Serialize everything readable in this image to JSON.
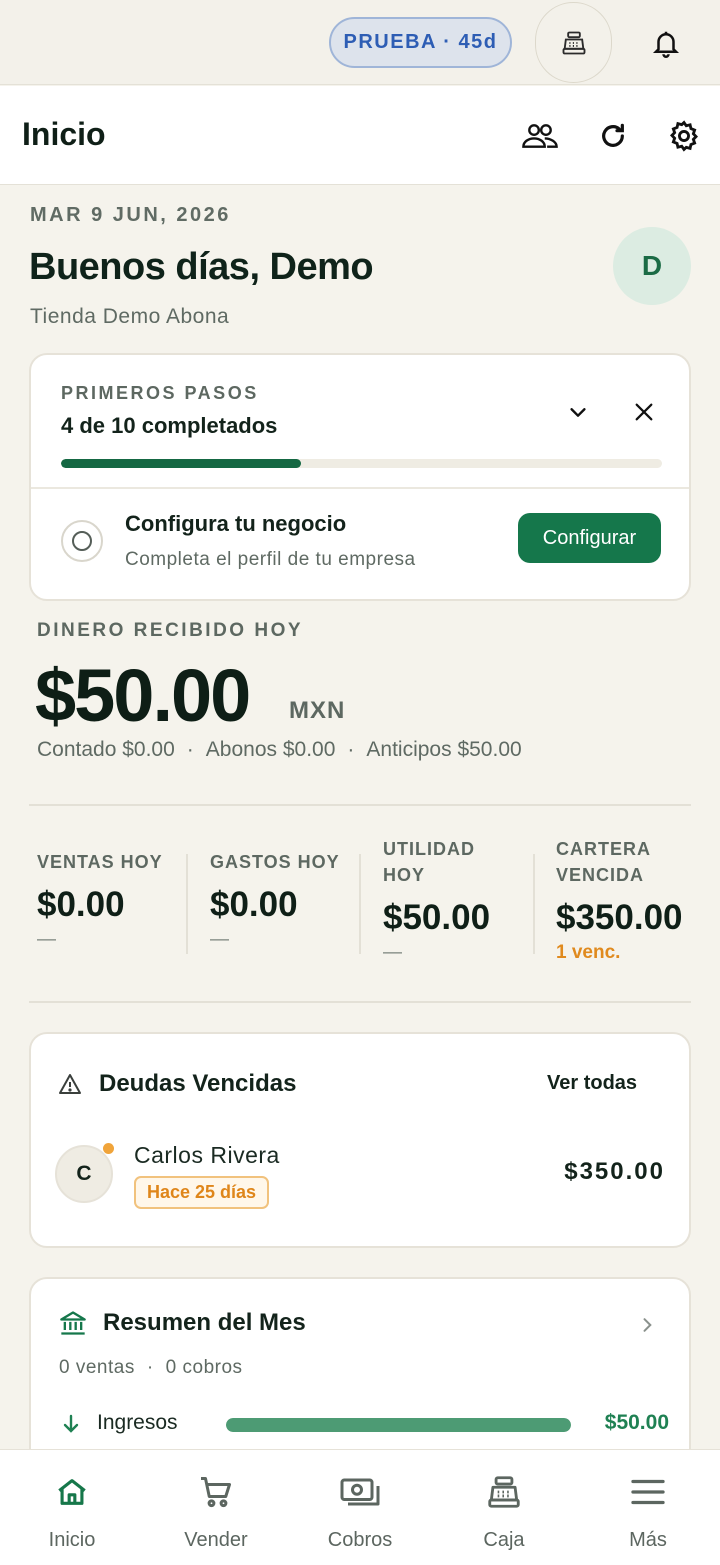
{
  "status": {
    "trial_badge": "PRUEBA · 45d"
  },
  "header": {
    "title": "Inicio"
  },
  "greeting": {
    "date": "MAR 9 JUN, 2026",
    "text": "Buenos días, Demo",
    "store": "Tienda Demo Abona",
    "avatar_initial": "D"
  },
  "onboarding": {
    "kicker": "PRIMEROS PASOS",
    "progress_text": "4 de 10 completados",
    "progress": 0.4,
    "task_title": "Configura tu negocio",
    "task_subtitle": "Completa el perfil de tu empresa",
    "cta_label": "Configurar"
  },
  "money": {
    "kicker": "DINERO RECIBIDO HOY",
    "amount": "$50.00",
    "currency": "MXN",
    "cash": "Contado $0.00",
    "installments": "Abonos $0.00",
    "advances": "Anticipos $50.00",
    "separator": "·"
  },
  "stats": [
    {
      "label": "VENTAS HOY",
      "value": "$0.00",
      "sub": "—"
    },
    {
      "label": "GASTOS HOY",
      "value": "$0.00",
      "sub": "—"
    },
    {
      "label": "UTILIDAD HOY",
      "value": "$50.00",
      "sub": "—"
    },
    {
      "label": "CARTERA VENCIDA",
      "value": "$350.00",
      "sub": "1 venc."
    }
  ],
  "debts": {
    "title": "Deudas Vencidas",
    "see_all": "Ver todas",
    "items": [
      {
        "initial": "C",
        "name": "Carlos Rivera",
        "badge": "Hace 25 días",
        "amount": "$350.00"
      }
    ]
  },
  "summary": {
    "title": "Resumen del Mes",
    "sales": "0 ventas",
    "collections": "0 cobros",
    "separator": "·",
    "income_label": "Ingresos",
    "income_value": "$50.00",
    "income_ratio": 1.0
  },
  "tabs": [
    {
      "label": "Inicio",
      "icon": "home-icon",
      "active": true
    },
    {
      "label": "Vender",
      "icon": "cart-icon",
      "active": false
    },
    {
      "label": "Cobros",
      "icon": "cash-icon",
      "active": false
    },
    {
      "label": "Caja",
      "icon": "register-icon",
      "active": false
    },
    {
      "label": "Más",
      "icon": "menu-icon",
      "active": false
    }
  ],
  "colors": {
    "brand": "#15774b",
    "warning": "#e08a1e",
    "trial": "#2d5db4"
  }
}
